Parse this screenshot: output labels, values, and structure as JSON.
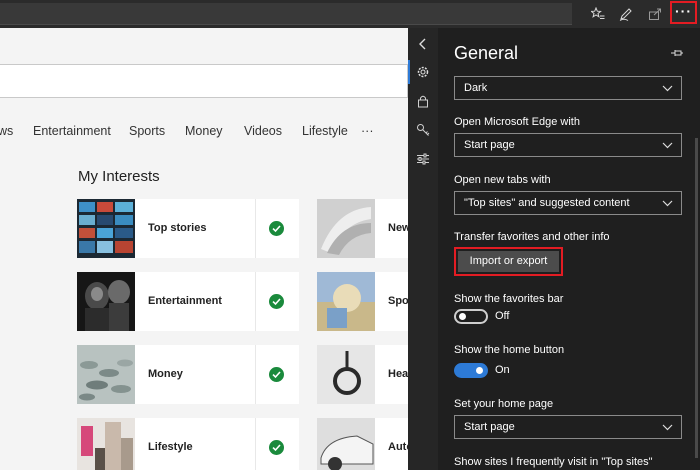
{
  "toolbar": {
    "icons": [
      "favorites-icon",
      "notes-pen-icon",
      "share-icon"
    ],
    "more_label": "···"
  },
  "page": {
    "nav_items": [
      "ws",
      "Entertainment",
      "Sports",
      "Money",
      "Videos",
      "Lifestyle",
      "···"
    ],
    "section_title": "My Interests",
    "left_cards": [
      {
        "title": "Top stories",
        "checked": true
      },
      {
        "title": "Entertainment",
        "checked": true
      },
      {
        "title": "Money",
        "checked": true
      },
      {
        "title": "Lifestyle",
        "checked": true
      }
    ],
    "right_cards": [
      {
        "title": "New"
      },
      {
        "title": "Spor"
      },
      {
        "title": "Heal"
      },
      {
        "title": "Auto"
      }
    ],
    "check_color": "#1a8a3c"
  },
  "side_strip": {
    "icons": [
      "collapse-chevron-icon",
      "gear-icon",
      "lock-icon",
      "key-icon",
      "sliders-icon"
    ],
    "accent_color": "#2d7ad6"
  },
  "settings": {
    "title": "General",
    "theme_select": "Dark",
    "open_with_label": "Open Microsoft Edge with",
    "open_with_select": "Start page",
    "new_tabs_label": "Open new tabs with",
    "new_tabs_select": "\"Top sites\" and suggested content",
    "transfer_label": "Transfer favorites and other info",
    "import_button": "Import or export",
    "favorites_bar_label": "Show the favorites bar",
    "favorites_bar_state": "Off",
    "home_button_label": "Show the home button",
    "home_button_state": "On",
    "home_page_label": "Set your home page",
    "home_page_select": "Start page",
    "frequent_sites_label": "Show sites I frequently visit in \"Top sites\"",
    "highlight_color": "#e31c23"
  }
}
